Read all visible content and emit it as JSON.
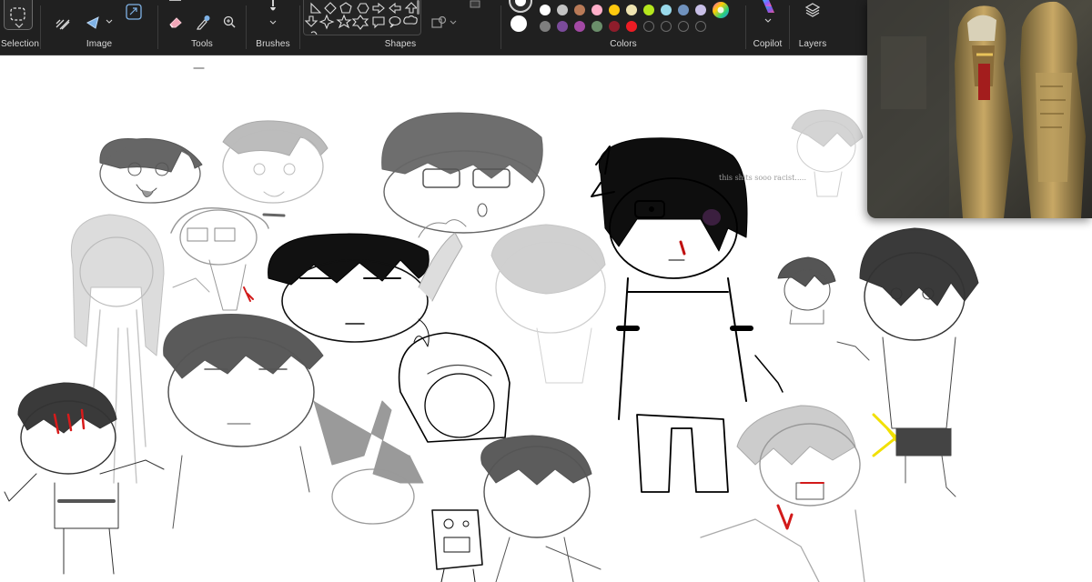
{
  "ribbon": {
    "groups": {
      "selection": "Selection",
      "image": "Image",
      "tools": "Tools",
      "brushes": "Brushes",
      "shapes": "Shapes",
      "colors": "Colors",
      "copilot": "Copilot",
      "layers": "Layers"
    },
    "palette": {
      "current_primary": "#ffffff",
      "current_secondary": "#ffffff",
      "row1": [
        "#ffffff",
        "#c3c3c3",
        "#b97a57",
        "#ffaec9",
        "#ffc90e",
        "#efe4b0",
        "#b5e61d",
        "#99d9ea",
        "#7092be",
        "#c8bfe7"
      ],
      "row2": [
        "#7f7f7f",
        "#7b4b9b",
        "#a349a4",
        "#6b8e6b",
        "#8e1d2b",
        "#ed1c24",
        "",
        "",
        "",
        ""
      ]
    }
  },
  "canvas": {
    "caption": "this shits sooo racist....."
  }
}
